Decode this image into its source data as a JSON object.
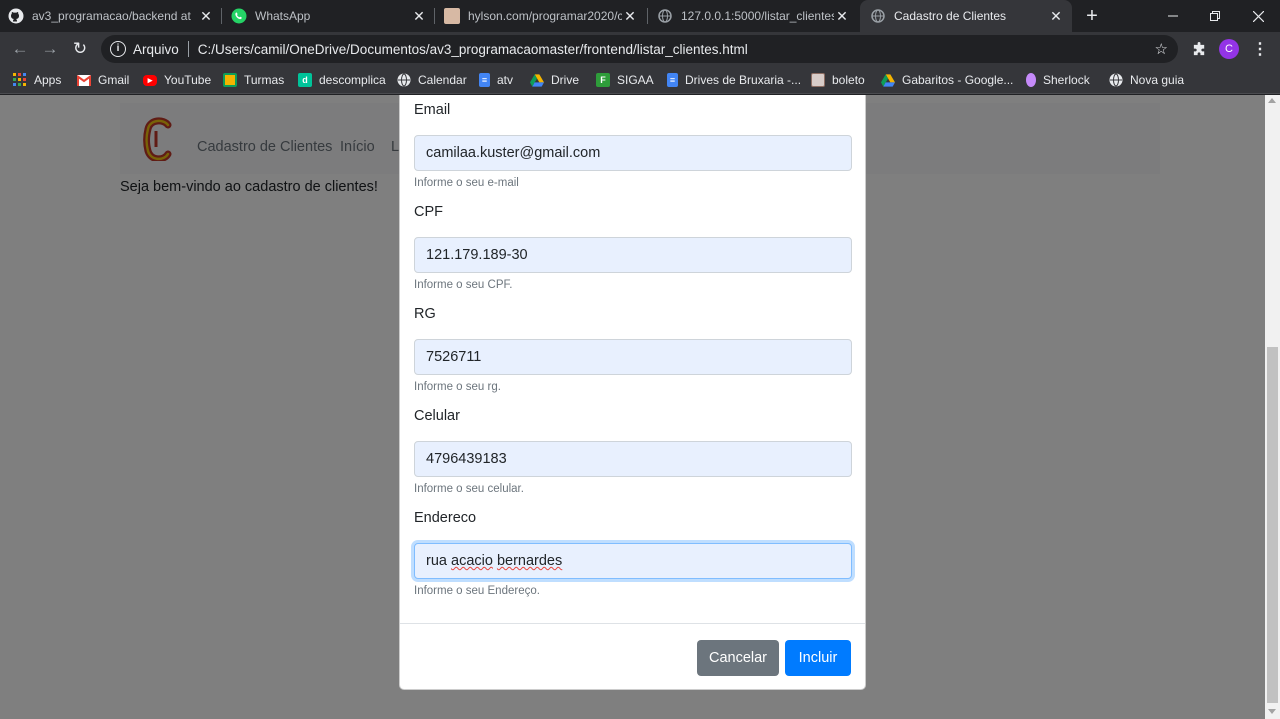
{
  "tabs": [
    {
      "title": "av3_programacao/backend at",
      "icon": "github-icon",
      "active": false
    },
    {
      "title": "WhatsApp",
      "icon": "whatsapp-icon",
      "active": false
    },
    {
      "title": "hylson.com/programar2020/co",
      "icon": "site-favicon",
      "active": false
    },
    {
      "title": "127.0.0.1:5000/listar_clientes",
      "icon": "globe-icon",
      "active": false
    },
    {
      "title": "Cadastro de Clientes",
      "icon": "globe-icon",
      "active": true
    }
  ],
  "address_bar": {
    "scheme_label": "Arquivo",
    "url": "C:/Users/camil/OneDrive/Documentos/av3_programacaomaster/frontend/listar_clientes.html"
  },
  "profile_initial": "C",
  "bookmarks": [
    {
      "label": "Apps",
      "icon": "apps-grid-icon",
      "color": "#f4b400"
    },
    {
      "label": "Gmail",
      "icon": "gmail-icon",
      "color": "#ea4335"
    },
    {
      "label": "YouTube",
      "icon": "youtube-icon",
      "color": "#ff0000"
    },
    {
      "label": "Turmas",
      "icon": "classroom-icon",
      "color": "#f4b400"
    },
    {
      "label": "descomplica",
      "icon": "descomplica-icon",
      "color": "#00c49a"
    },
    {
      "label": "Calendar",
      "icon": "globe-icon",
      "color": "#9aa0a6"
    },
    {
      "label": "atv",
      "icon": "docs-icon",
      "color": "#4285f4"
    },
    {
      "label": "Drive",
      "icon": "drive-icon",
      "color": "#0f9d58"
    },
    {
      "label": "SIGAA",
      "icon": "sigaa-icon",
      "color": "#2e9d3a"
    },
    {
      "label": "Drives de Bruxaria -...",
      "icon": "docs-icon",
      "color": "#4285f4"
    },
    {
      "label": "boleto",
      "icon": "image-icon",
      "color": "#8d6e63"
    },
    {
      "label": "Gabaritos - Google...",
      "icon": "drive-icon",
      "color": "#0f9d58"
    },
    {
      "label": "Sherlock",
      "icon": "sherlock-icon",
      "color": "#c58af9"
    },
    {
      "label": "Nova guia",
      "icon": "globe-icon",
      "color": "#9aa0a6"
    }
  ],
  "page": {
    "brand": "Cadastro de Clientes",
    "nav_link_inicio": "Início",
    "nav_link_partial": "L",
    "welcome": "Seja bem-vindo ao cadastro de clientes!"
  },
  "modal": {
    "fields": [
      {
        "label": "Email",
        "value": "camilaa.kuster@gmail.com",
        "help": "Informe o seu e-mail"
      },
      {
        "label": "CPF",
        "value": "121.179.189-30",
        "help": "Informe o seu CPF."
      },
      {
        "label": "RG",
        "value": "7526711",
        "help": "Informe o seu rg."
      },
      {
        "label": "Celular",
        "value": "4796439183",
        "help": "Informe o seu celular."
      },
      {
        "label": "Endereco",
        "value_parts": [
          "rua ",
          "acacio",
          " ",
          "bernardes"
        ],
        "help": "Informe o seu Endereço."
      }
    ],
    "cancel_label": "Cancelar",
    "submit_label": "Incluir"
  }
}
